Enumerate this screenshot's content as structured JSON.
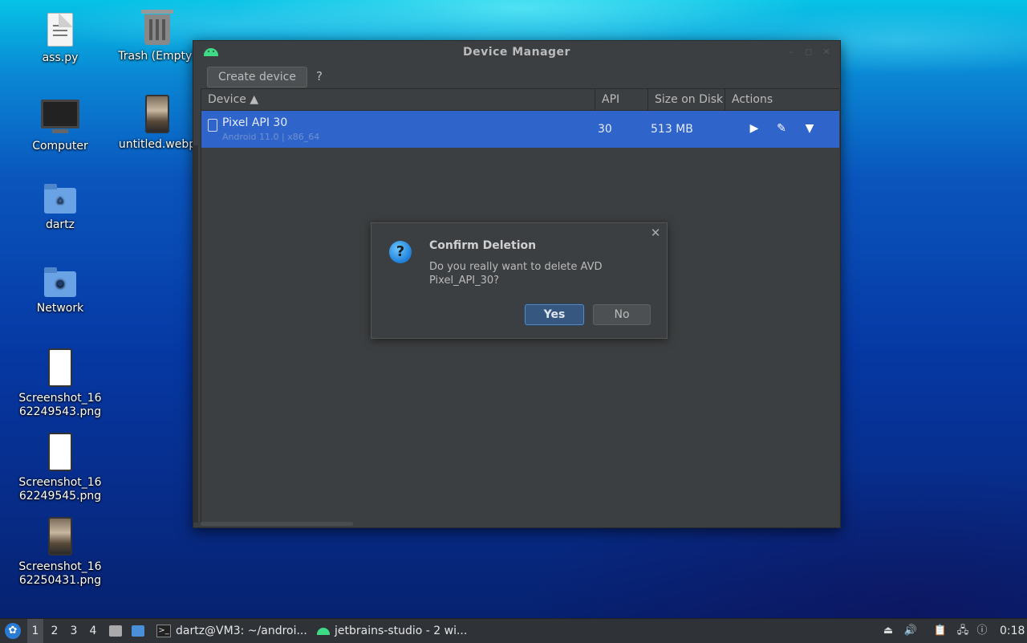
{
  "desktop": {
    "icons": [
      {
        "label": "ass.py",
        "type": "document"
      },
      {
        "label": "Trash (Empty)",
        "type": "trash"
      },
      {
        "label": "Computer",
        "type": "monitor"
      },
      {
        "label": "untitled.webp",
        "type": "photo"
      },
      {
        "label": "dartz",
        "type": "home-folder"
      },
      {
        "label": "Network",
        "type": "network-folder"
      },
      {
        "label": "Screenshot_1662249543.png",
        "type": "phone"
      },
      {
        "label": "Screenshot_1662249545.png",
        "type": "phone"
      },
      {
        "label": "Screenshot_1662250431.png",
        "type": "photo"
      }
    ]
  },
  "window": {
    "title": "Device Manager",
    "toolbar": {
      "create_label": "Create device",
      "help_label": "?"
    },
    "table": {
      "columns": {
        "device": "Device ▲",
        "api": "API",
        "size": "Size on Disk",
        "actions": "Actions"
      },
      "rows": [
        {
          "name": "Pixel API 30",
          "subtitle": "Android 11.0 | x86_64",
          "api": "30",
          "size": "513 MB"
        }
      ]
    }
  },
  "dialog": {
    "title": "Confirm Deletion",
    "message": "Do you really want to delete AVD Pixel_API_30?",
    "yes_label": "Yes",
    "no_label": "No",
    "icon_glyph": "?"
  },
  "taskbar": {
    "workspaces": [
      "1",
      "2",
      "3",
      "4"
    ],
    "active_workspace": "1",
    "apps": [
      {
        "label": "dartz@VM3: ~/androi...",
        "icon": "terminal-icon"
      },
      {
        "label": "jetbrains-studio - 2 wi...",
        "icon": "android-icon"
      }
    ],
    "clock": "0:18"
  },
  "colors": {
    "selection": "#2f65ca",
    "window_bg": "#3c3f41",
    "android_green": "#3ddc84"
  }
}
